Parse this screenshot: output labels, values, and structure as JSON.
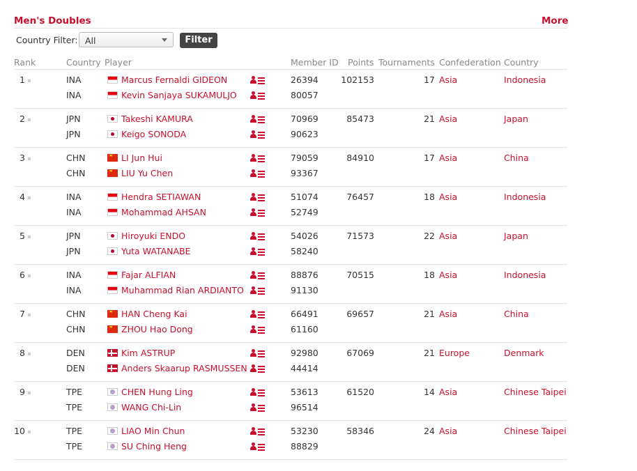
{
  "title": "Men's Doubles",
  "more_label": "More",
  "filter": {
    "label": "Country Filter:",
    "selected": "All",
    "button": "Filter"
  },
  "headers": {
    "rank": "Rank",
    "country": "Country",
    "player": "Player",
    "member_id": "Member ID",
    "points": "Points",
    "tournaments": "Tournaments",
    "confederation": "Confederation",
    "country_name": "Country"
  },
  "rows": [
    {
      "rank": "1",
      "points": "102153",
      "tournaments": "17",
      "confederation": "Asia",
      "country_name": "Indonesia",
      "players": [
        {
          "code": "INA",
          "flag": "ina",
          "name": "Marcus Fernaldi GIDEON",
          "member_id": "26394"
        },
        {
          "code": "INA",
          "flag": "ina",
          "name": "Kevin Sanjaya SUKAMULJO",
          "member_id": "80057"
        }
      ]
    },
    {
      "rank": "2",
      "points": "85473",
      "tournaments": "21",
      "confederation": "Asia",
      "country_name": "Japan",
      "players": [
        {
          "code": "JPN",
          "flag": "jpn",
          "name": "Takeshi KAMURA",
          "member_id": "70969"
        },
        {
          "code": "JPN",
          "flag": "jpn",
          "name": "Keigo SONODA",
          "member_id": "90623"
        }
      ]
    },
    {
      "rank": "3",
      "points": "84910",
      "tournaments": "17",
      "confederation": "Asia",
      "country_name": "China",
      "players": [
        {
          "code": "CHN",
          "flag": "chn",
          "name": "LI Jun Hui",
          "member_id": "79059"
        },
        {
          "code": "CHN",
          "flag": "chn",
          "name": "LIU Yu Chen",
          "member_id": "93367"
        }
      ]
    },
    {
      "rank": "4",
      "points": "76457",
      "tournaments": "18",
      "confederation": "Asia",
      "country_name": "Indonesia",
      "players": [
        {
          "code": "INA",
          "flag": "ina",
          "name": "Hendra SETIAWAN",
          "member_id": "51074"
        },
        {
          "code": "INA",
          "flag": "ina",
          "name": "Mohammad AHSAN",
          "member_id": "52749"
        }
      ]
    },
    {
      "rank": "5",
      "points": "71573",
      "tournaments": "22",
      "confederation": "Asia",
      "country_name": "Japan",
      "players": [
        {
          "code": "JPN",
          "flag": "jpn",
          "name": "Hiroyuki ENDO",
          "member_id": "54026"
        },
        {
          "code": "JPN",
          "flag": "jpn",
          "name": "Yuta WATANABE",
          "member_id": "58240"
        }
      ]
    },
    {
      "rank": "6",
      "points": "70515",
      "tournaments": "18",
      "confederation": "Asia",
      "country_name": "Indonesia",
      "players": [
        {
          "code": "INA",
          "flag": "ina",
          "name": "Fajar ALFIAN",
          "member_id": "88876"
        },
        {
          "code": "INA",
          "flag": "ina",
          "name": "Muhammad Rian ARDIANTO",
          "member_id": "91130"
        }
      ]
    },
    {
      "rank": "7",
      "points": "69657",
      "tournaments": "21",
      "confederation": "Asia",
      "country_name": "China",
      "players": [
        {
          "code": "CHN",
          "flag": "chn",
          "name": "HAN Cheng Kai",
          "member_id": "66491"
        },
        {
          "code": "CHN",
          "flag": "chn",
          "name": "ZHOU Hao Dong",
          "member_id": "61160"
        }
      ]
    },
    {
      "rank": "8",
      "points": "67069",
      "tournaments": "21",
      "confederation": "Europe",
      "country_name": "Denmark",
      "players": [
        {
          "code": "DEN",
          "flag": "den",
          "name": "Kim ASTRUP",
          "member_id": "92980"
        },
        {
          "code": "DEN",
          "flag": "den",
          "name": "Anders Skaarup RASMUSSEN",
          "member_id": "44414"
        }
      ]
    },
    {
      "rank": "9",
      "points": "61520",
      "tournaments": "14",
      "confederation": "Asia",
      "country_name": "Chinese Taipei",
      "players": [
        {
          "code": "TPE",
          "flag": "tpe",
          "name": "CHEN Hung Ling",
          "member_id": "53613"
        },
        {
          "code": "TPE",
          "flag": "tpe",
          "name": "WANG Chi-Lin",
          "member_id": "96514"
        }
      ]
    },
    {
      "rank": "10",
      "points": "58346",
      "tournaments": "24",
      "confederation": "Asia",
      "country_name": "Chinese Taipei",
      "players": [
        {
          "code": "TPE",
          "flag": "tpe",
          "name": "LIAO Min Chun",
          "member_id": "53230"
        },
        {
          "code": "TPE",
          "flag": "tpe",
          "name": "SU Ching Heng",
          "member_id": "88829"
        }
      ]
    }
  ],
  "colors": {
    "accent": "#c8102e",
    "header_text": "#888888",
    "button_bg": "#444444"
  },
  "icons": {
    "player_profile": "player-profile-icon",
    "select_arrow": "chevron-down-icon"
  }
}
